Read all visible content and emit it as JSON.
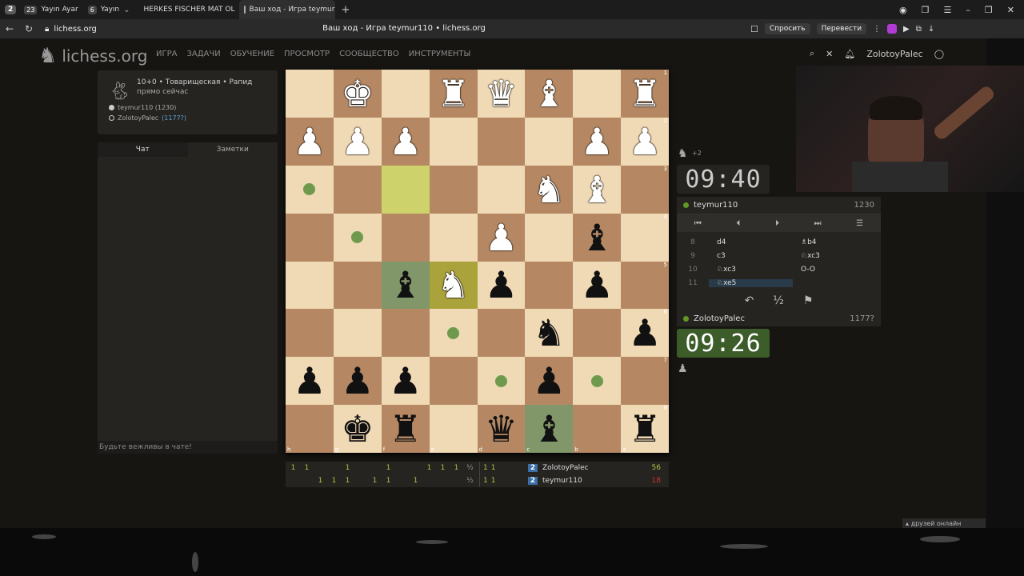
{
  "browser": {
    "workspace_num": "2",
    "tabs": [
      {
        "badge": "23",
        "label": "Yayın Ayar"
      },
      {
        "badge": "6",
        "label": "Yayın"
      },
      {
        "label": "HERKES FISCHER MAT OL"
      },
      {
        "label": "Ваш ход - Игра teymur"
      }
    ],
    "url": "lichess.org",
    "page_title": "Ваш ход - Игра teymur110 • lichess.org",
    "ask_label": "Спросить",
    "translate_label": "Перевести"
  },
  "site": {
    "logo": "lichess.org",
    "menu": [
      "ИГРА",
      "ЗАДАЧИ",
      "ОБУЧЕНИЕ",
      "ПРОСМОТР",
      "СООБЩЕСТВО",
      "ИНСТРУМЕНТЫ"
    ],
    "username": "ZolotoyPalec"
  },
  "game_info": {
    "line1": "10+0 • Товарищеская • Рапид",
    "line2": "прямо сейчас",
    "white_player": "teymur110 (1230)",
    "black_player": "ZolotoyPalec",
    "black_rating": "(1177?)"
  },
  "chat": {
    "tab_chat": "Чат",
    "tab_notes": "Заметки",
    "footer": "Будьте вежливы в чате!"
  },
  "board": {
    "rank_labels": [
      "1",
      "2",
      "3",
      "4",
      "5",
      "6",
      "7",
      "8"
    ],
    "file_labels": [
      "h",
      "g",
      "f",
      "e",
      "d",
      "c",
      "b",
      "a"
    ],
    "rows": [
      [
        "",
        "wK",
        "",
        "wR",
        "wQ",
        "wB",
        "",
        "wR"
      ],
      [
        "wP",
        "wP",
        "wP",
        "",
        "",
        "",
        "wP",
        "wP"
      ],
      [
        "",
        "",
        "",
        "",
        "",
        "wN",
        "wB",
        ""
      ],
      [
        "",
        "",
        "",
        "",
        "wP",
        "",
        "bB",
        ""
      ],
      [
        "",
        "",
        "bB",
        "wN",
        "bP",
        "",
        "bP",
        ""
      ],
      [
        "",
        "",
        "",
        "",
        "",
        "bN",
        "",
        "bP"
      ],
      [
        "bP",
        "bP",
        "bP",
        "",
        "",
        "bP",
        "",
        ""
      ],
      [
        "",
        "bK",
        "bR",
        "",
        "bQ",
        "bB",
        "",
        "bR"
      ]
    ]
  },
  "clocks": {
    "opponent_extra": "+2",
    "top_time": "09:40",
    "bottom_time": "09:26"
  },
  "moves_panel": {
    "top_player": "teymur110",
    "top_rating": "1230",
    "bottom_player": "ZolotoyPalec",
    "bottom_rating": "1177?",
    "moves": [
      {
        "no": "8",
        "white": "d4",
        "black": "♗b4"
      },
      {
        "no": "9",
        "white": "c3",
        "black": "♘xc3"
      },
      {
        "no": "10",
        "white": "♘xc3",
        "black": "O-O"
      },
      {
        "no": "11",
        "white": "♘xe5",
        "black": ""
      }
    ],
    "draw_label": "½"
  },
  "crosstable": {
    "top_left": [
      "1",
      "1",
      "",
      "",
      "1",
      "",
      "",
      "1",
      "",
      "",
      "1",
      "1",
      "1",
      "½"
    ],
    "bottom_left": [
      "",
      "",
      "1",
      "1",
      "1",
      "",
      "1",
      "1",
      "",
      "1",
      "",
      "",
      "",
      "½"
    ],
    "top_right_marks": [
      "1",
      "1",
      ""
    ],
    "bottom_right_marks": [
      "",
      "1",
      "1"
    ],
    "top_name": "ZolotoyPalec",
    "top_score": "56",
    "top_rank": "2",
    "bottom_name": "teymur110",
    "bottom_score": "18",
    "bottom_rank": "2"
  },
  "friends_online": "друзей онлайн",
  "colors": {
    "accent_green": "#629924",
    "score_green": "#a9c23f",
    "score_red": "#cc3333"
  }
}
